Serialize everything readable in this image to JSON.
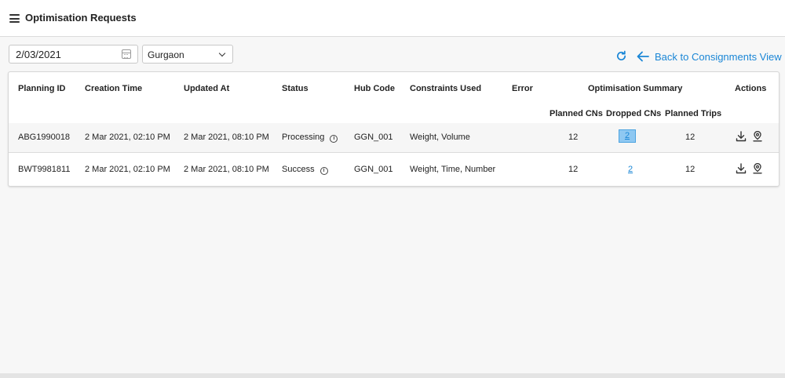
{
  "header": {
    "title": "Optimisation Requests",
    "menu_icon": "hamburger-menu-icon"
  },
  "filters": {
    "date_value": "2/03/2021",
    "date_icon": "calendar-icon",
    "hub_value": "Gurgaon",
    "hub_icon": "chevron-down-icon"
  },
  "toolbar": {
    "refresh_icon": "refresh-icon",
    "back_label": "Back to Consignments View",
    "back_icon": "arrow-left-icon"
  },
  "colors": {
    "accent": "#1a86d6",
    "highlight": "#8ec8f2"
  },
  "table": {
    "headers": {
      "planning_id": "Planning ID",
      "creation_time": "Creation Time",
      "updated_at": "Updated At",
      "status": "Status",
      "hub_code": "Hub Code",
      "constraints": "Constraints Used",
      "error": "Error",
      "summary": "Optimisation Summary",
      "actions": "Actions",
      "planned_cns": "Planned CNs",
      "dropped_cns": "Dropped CNs",
      "planned_trips": "Planned Trips"
    },
    "rows": [
      {
        "planning_id": "ABG1990018",
        "creation_time": "2 Mar 2021, 02:10 PM",
        "updated_at": "2 Mar 2021, 08:10 PM",
        "status": "Processing",
        "hub_code": "GGN_001",
        "constraints": "Weight, Volume",
        "error": "",
        "planned_cns": "12",
        "dropped_cns": "2",
        "planned_trips": "12"
      },
      {
        "planning_id": "BWT9981811",
        "creation_time": "2 Mar 2021, 02:10 PM",
        "updated_at": "2 Mar 2021, 08:10 PM",
        "status": "Success",
        "hub_code": "GGN_001",
        "constraints": "Weight, Time, Number",
        "error": "",
        "planned_cns": "12",
        "dropped_cns": "2",
        "planned_trips": "12"
      }
    ]
  }
}
